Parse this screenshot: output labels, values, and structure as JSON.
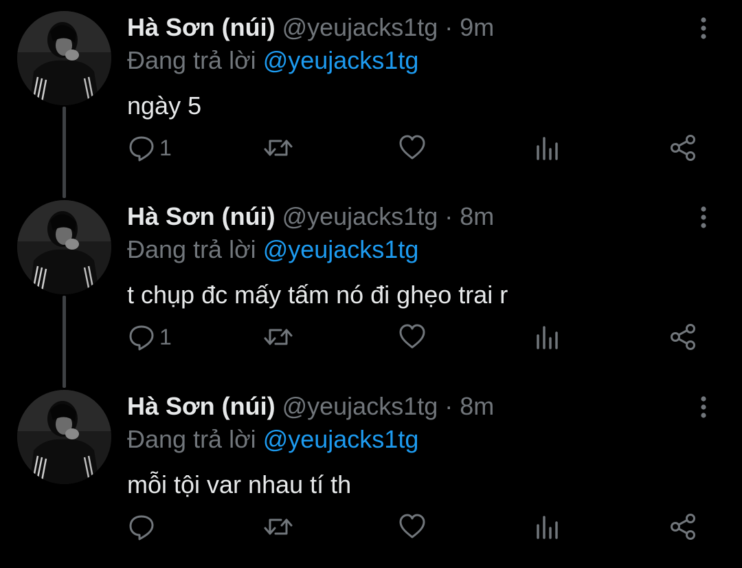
{
  "colors": {
    "background": "#000000",
    "text_primary": "#e7e9ea",
    "text_secondary": "#71767b",
    "accent": "#1d9bf0",
    "thread_line": "#3e4144"
  },
  "tweets": [
    {
      "author_name": "Hà Sơn (núi)",
      "handle": "@yeujacks1tg",
      "separator": "·",
      "time": "9m",
      "replying_prefix": "Đang trả lời",
      "replying_to": "@yeujacks1tg",
      "text": "ngày 5",
      "reply_count": "1",
      "icons": [
        "avatar",
        "more-vertical-icon",
        "reply-icon",
        "retweet-icon",
        "like-icon",
        "analytics-icon",
        "share-icon"
      ]
    },
    {
      "author_name": "Hà Sơn (núi)",
      "handle": "@yeujacks1tg",
      "separator": "·",
      "time": "8m",
      "replying_prefix": "Đang trả lời",
      "replying_to": "@yeujacks1tg",
      "text": "t chụp đc mấy tấm nó đi ghẹo trai r",
      "reply_count": "1",
      "icons": [
        "avatar",
        "more-vertical-icon",
        "reply-icon",
        "retweet-icon",
        "like-icon",
        "analytics-icon",
        "share-icon"
      ]
    },
    {
      "author_name": "Hà Sơn (núi)",
      "handle": "@yeujacks1tg",
      "separator": "·",
      "time": "8m",
      "replying_prefix": "Đang trả lời",
      "replying_to": "@yeujacks1tg",
      "text": "mỗi tội var nhau tí th",
      "reply_count": "",
      "icons": [
        "avatar",
        "more-vertical-icon",
        "reply-icon",
        "retweet-icon",
        "like-icon",
        "analytics-icon",
        "share-icon"
      ]
    }
  ]
}
